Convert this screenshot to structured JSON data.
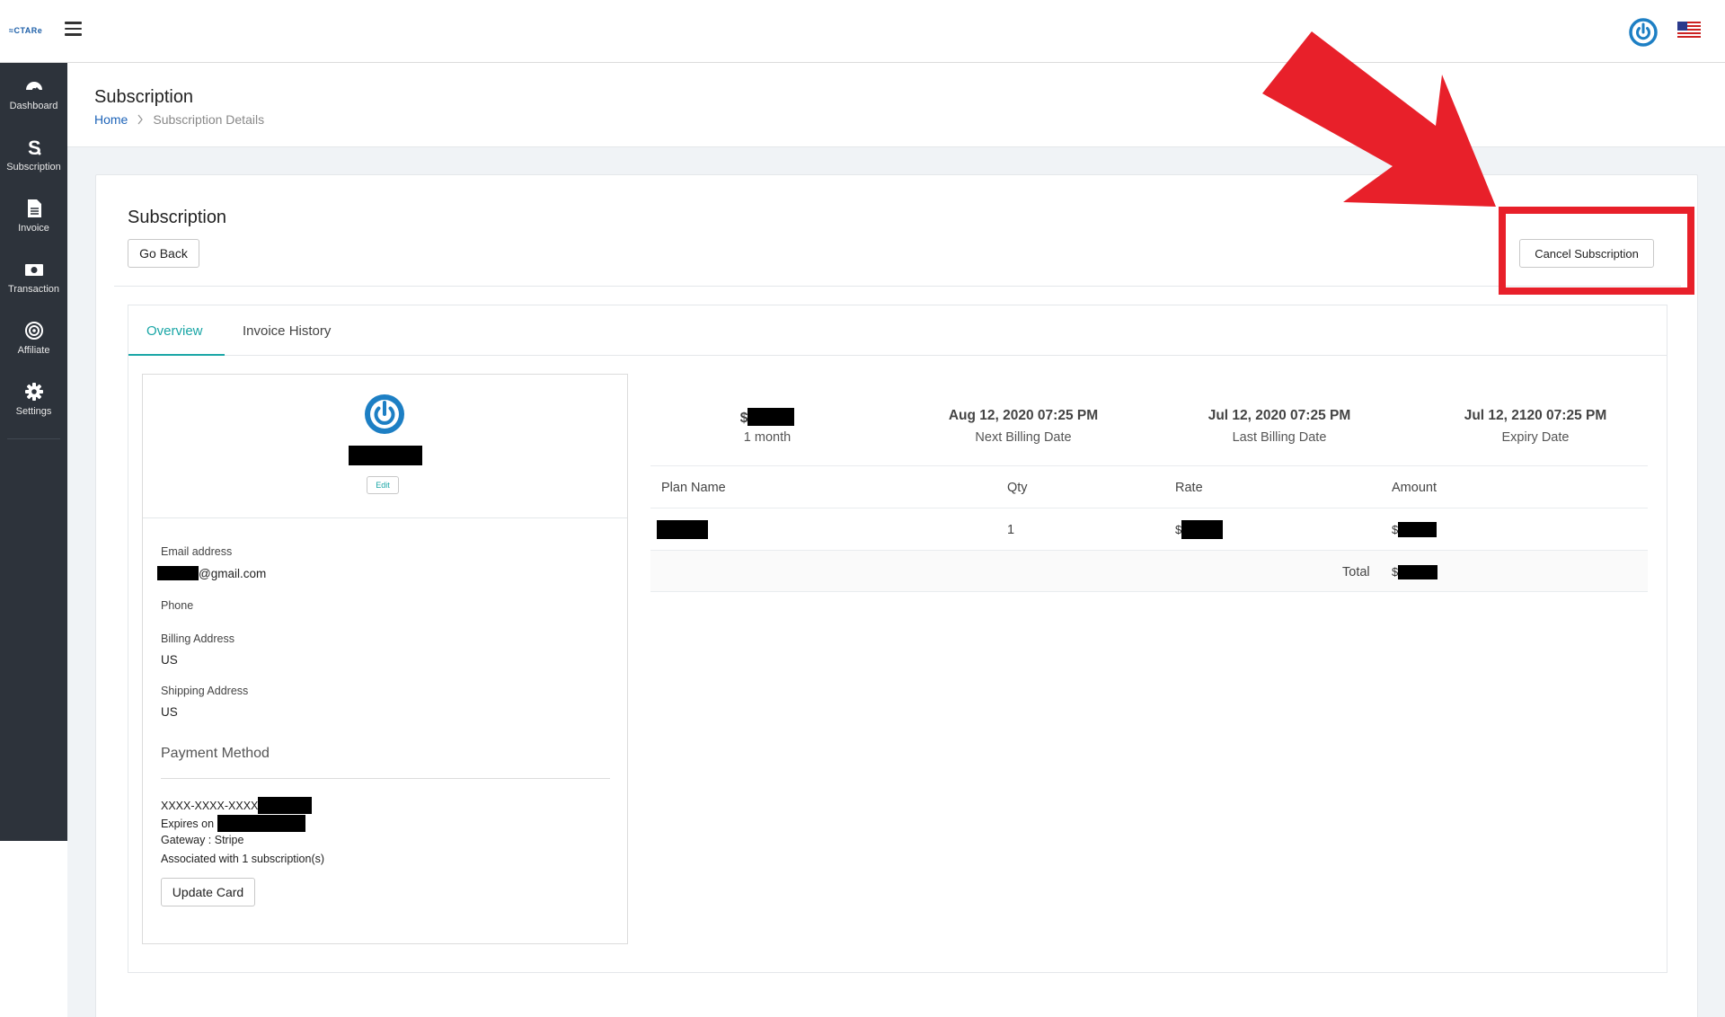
{
  "topbar": {
    "logo_text": "≈CTARe",
    "menu_icon": "hamburger-icon",
    "power_icon": "power-icon",
    "flag_icon": "us-flag-icon"
  },
  "sidebar": {
    "items": [
      {
        "label": "Dashboard",
        "icon": "dashboard-gauge-icon"
      },
      {
        "label": "Subscription",
        "icon": "dollar-s-icon"
      },
      {
        "label": "Invoice",
        "icon": "document-icon"
      },
      {
        "label": "Transaction",
        "icon": "money-bill-icon"
      },
      {
        "label": "Affiliate",
        "icon": "target-icon"
      },
      {
        "label": "Settings",
        "icon": "gear-icon"
      }
    ]
  },
  "header": {
    "title": "Subscription",
    "breadcrumb_home": "Home",
    "breadcrumb_current": "Subscription Details"
  },
  "card": {
    "title": "Subscription",
    "go_back_label": "Go Back",
    "cancel_label": "Cancel Subscription"
  },
  "tabs": [
    {
      "label": "Overview",
      "active": true
    },
    {
      "label": "Invoice History",
      "active": false
    }
  ],
  "customer": {
    "edit_label": "Edit",
    "email_label": "Email address",
    "email_suffix": "@gmail.com",
    "phone_label": "Phone",
    "billing_label": "Billing Address",
    "billing_value": "US",
    "shipping_label": "Shipping Address",
    "shipping_value": "US"
  },
  "payment": {
    "title": "Payment Method",
    "card_prefix": "XXXX-XXXX-XXXX",
    "expires_prefix": "Expires on",
    "gateway": "Gateway : Stripe",
    "associated": "Associated with 1 subscription(s)",
    "update_label": "Update Card"
  },
  "summary": {
    "price_prefix": "$",
    "period": "1 month",
    "next_billing_value": "Aug 12, 2020 07:25 PM",
    "next_billing_label": "Next Billing Date",
    "last_billing_value": "Jul 12, 2020 07:25 PM",
    "last_billing_label": "Last Billing Date",
    "expiry_value": "Jul 12, 2120 07:25 PM",
    "expiry_label": "Expiry Date"
  },
  "table": {
    "headers": [
      "Plan Name",
      "Qty",
      "Rate",
      "Amount"
    ],
    "row": {
      "qty": "1",
      "rate_prefix": "$",
      "amount_prefix": "$"
    },
    "total_label": "Total",
    "total_prefix": "$"
  },
  "colors": {
    "accent": "#1aa6a6",
    "link": "#1d63b8",
    "sidebar_bg": "#2d333b",
    "annotation_red": "#e8202a"
  }
}
